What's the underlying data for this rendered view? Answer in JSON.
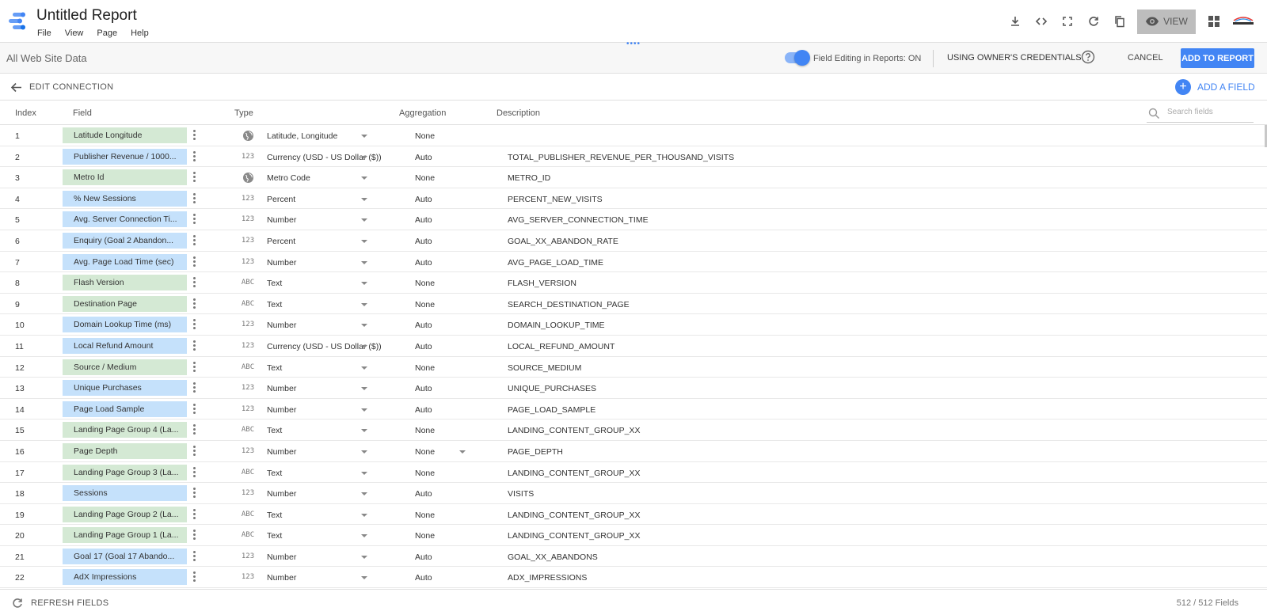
{
  "header": {
    "title": "Untitled Report",
    "menu": [
      "File",
      "View",
      "Page",
      "Help"
    ],
    "view_label": "VIEW"
  },
  "datasource": {
    "name": "All Web Site Data",
    "field_editing_label": "Field Editing in Reports: ON",
    "field_editing_on": true,
    "credentials_label": "USING OWNER'S CREDENTIALS",
    "cancel_label": "CANCEL",
    "add_to_report_label": "ADD TO REPORT"
  },
  "edit_bar": {
    "edit_connection_label": "EDIT CONNECTION",
    "add_field_label": "ADD A FIELD"
  },
  "columns": {
    "index": "Index",
    "field": "Field",
    "type": "Type",
    "aggregation": "Aggregation",
    "description": "Description",
    "search_placeholder": "Search fields"
  },
  "fields": [
    {
      "index": "1",
      "name": "Latitude Longitude",
      "kind": "dimension",
      "type_icon": "globe-icon",
      "type": "Latitude, Longitude",
      "aggregation": "None",
      "description": ""
    },
    {
      "index": "2",
      "name": "Publisher Revenue / 1000...",
      "kind": "metric",
      "type_icon": "number-icon",
      "type": "Currency (USD - US Dollar ($))",
      "aggregation": "Auto",
      "description": "TOTAL_PUBLISHER_REVENUE_PER_THOUSAND_VISITS"
    },
    {
      "index": "3",
      "name": "Metro Id",
      "kind": "dimension",
      "type_icon": "globe-icon",
      "type": "Metro Code",
      "aggregation": "None",
      "description": "METRO_ID"
    },
    {
      "index": "4",
      "name": "% New Sessions",
      "kind": "metric",
      "type_icon": "number-icon",
      "type": "Percent",
      "aggregation": "Auto",
      "description": "PERCENT_NEW_VISITS"
    },
    {
      "index": "5",
      "name": "Avg. Server Connection Ti...",
      "kind": "metric",
      "type_icon": "number-icon",
      "type": "Number",
      "aggregation": "Auto",
      "description": "AVG_SERVER_CONNECTION_TIME"
    },
    {
      "index": "6",
      "name": "Enquiry (Goal 2 Abandon...",
      "kind": "metric",
      "type_icon": "number-icon",
      "type": "Percent",
      "aggregation": "Auto",
      "description": "GOAL_XX_ABANDON_RATE"
    },
    {
      "index": "7",
      "name": "Avg. Page Load Time (sec)",
      "kind": "metric",
      "type_icon": "number-icon",
      "type": "Number",
      "aggregation": "Auto",
      "description": "AVG_PAGE_LOAD_TIME"
    },
    {
      "index": "8",
      "name": "Flash Version",
      "kind": "dimension",
      "type_icon": "text-icon",
      "type": "Text",
      "aggregation": "None",
      "description": "FLASH_VERSION"
    },
    {
      "index": "9",
      "name": "Destination Page",
      "kind": "dimension",
      "type_icon": "text-icon",
      "type": "Text",
      "aggregation": "None",
      "description": "SEARCH_DESTINATION_PAGE"
    },
    {
      "index": "10",
      "name": "Domain Lookup Time (ms)",
      "kind": "metric",
      "type_icon": "number-icon",
      "type": "Number",
      "aggregation": "Auto",
      "description": "DOMAIN_LOOKUP_TIME"
    },
    {
      "index": "11",
      "name": "Local Refund Amount",
      "kind": "metric",
      "type_icon": "number-icon",
      "type": "Currency (USD - US Dollar ($))",
      "aggregation": "Auto",
      "description": "LOCAL_REFUND_AMOUNT"
    },
    {
      "index": "12",
      "name": "Source / Medium",
      "kind": "dimension",
      "type_icon": "text-icon",
      "type": "Text",
      "aggregation": "None",
      "description": "SOURCE_MEDIUM"
    },
    {
      "index": "13",
      "name": "Unique Purchases",
      "kind": "metric",
      "type_icon": "number-icon",
      "type": "Number",
      "aggregation": "Auto",
      "description": "UNIQUE_PURCHASES"
    },
    {
      "index": "14",
      "name": "Page Load Sample",
      "kind": "metric",
      "type_icon": "number-icon",
      "type": "Number",
      "aggregation": "Auto",
      "description": "PAGE_LOAD_SAMPLE"
    },
    {
      "index": "15",
      "name": "Landing Page Group 4 (La...",
      "kind": "dimension",
      "type_icon": "text-icon",
      "type": "Text",
      "aggregation": "None",
      "description": "LANDING_CONTENT_GROUP_XX"
    },
    {
      "index": "16",
      "name": "Page Depth",
      "kind": "dimension",
      "type_icon": "number-icon",
      "type": "Number",
      "aggregation": "None",
      "description": "PAGE_DEPTH",
      "agg_dropdown": true
    },
    {
      "index": "17",
      "name": "Landing Page Group 3 (La...",
      "kind": "dimension",
      "type_icon": "text-icon",
      "type": "Text",
      "aggregation": "None",
      "description": "LANDING_CONTENT_GROUP_XX"
    },
    {
      "index": "18",
      "name": "Sessions",
      "kind": "metric",
      "type_icon": "number-icon",
      "type": "Number",
      "aggregation": "Auto",
      "description": "VISITS"
    },
    {
      "index": "19",
      "name": "Landing Page Group 2 (La...",
      "kind": "dimension",
      "type_icon": "text-icon",
      "type": "Text",
      "aggregation": "None",
      "description": "LANDING_CONTENT_GROUP_XX"
    },
    {
      "index": "20",
      "name": "Landing Page Group 1 (La...",
      "kind": "dimension",
      "type_icon": "text-icon",
      "type": "Text",
      "aggregation": "None",
      "description": "LANDING_CONTENT_GROUP_XX"
    },
    {
      "index": "21",
      "name": "Goal 17 (Goal 17 Abando...",
      "kind": "metric",
      "type_icon": "number-icon",
      "type": "Number",
      "aggregation": "Auto",
      "description": "GOAL_XX_ABANDONS"
    },
    {
      "index": "22",
      "name": "AdX Impressions",
      "kind": "metric",
      "type_icon": "number-icon",
      "type": "Number",
      "aggregation": "Auto",
      "description": "ADX_IMPRESSIONS"
    }
  ],
  "type_icon_glyphs": {
    "number-icon": "123",
    "text-icon": "ABC"
  },
  "footer": {
    "refresh_label": "REFRESH FIELDS",
    "field_count": "512 / 512 Fields"
  },
  "colors": {
    "accent": "#4285f4",
    "dimension_chip": "#d4e9d4",
    "metric_chip": "#c5e1fb"
  }
}
